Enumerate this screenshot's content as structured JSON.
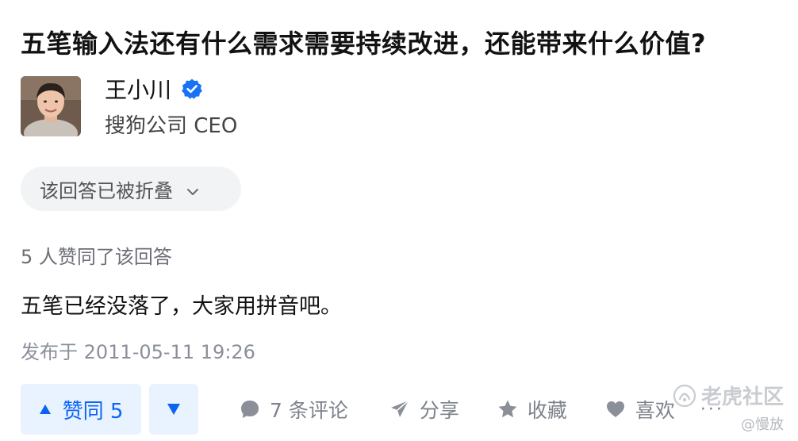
{
  "question": {
    "title": "五笔输入法还有什么需求需要持续改进，还能带来什么价值?"
  },
  "author": {
    "name": "王小川",
    "headline": "搜狗公司 CEO",
    "verified_icon": "verified-badge-icon",
    "verified_color": "#1772f6"
  },
  "answer": {
    "collapsed_label": "该回答已被折叠",
    "voters_text": "5 人赞同了该回答",
    "body": "五笔已经没落了，大家用拼音吧。",
    "published": "发布于 2011-05-11 19:26"
  },
  "actions": {
    "upvote_label": "赞同 5",
    "comments_label": "7 条评论",
    "share_label": "分享",
    "collect_label": "收藏",
    "like_label": "喜欢",
    "more_label": "···"
  },
  "watermark": {
    "brand": "老虎社区",
    "user": "@慢放"
  },
  "colors": {
    "accent": "#0b63f6",
    "accent_bg": "#e9f2ff",
    "muted": "#7d828b"
  }
}
